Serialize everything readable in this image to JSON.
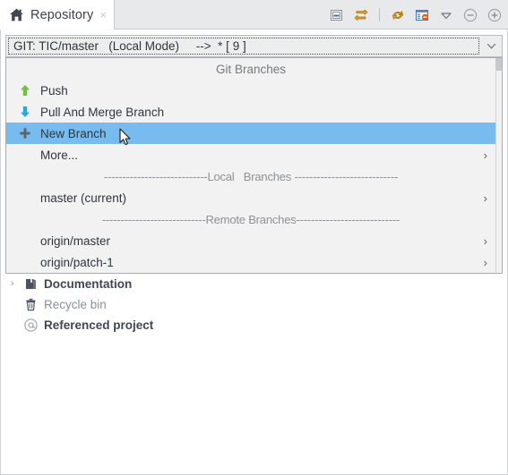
{
  "tab": {
    "title": "Repository",
    "home_icon": "home-icon",
    "close_icon": "close-icon",
    "close_glyph": "×"
  },
  "toolbar": {
    "buttons": [
      {
        "name": "minimize-view-icon",
        "title": "Minimize"
      },
      {
        "name": "sync-arrows-icon",
        "title": "Synchronize"
      },
      {
        "name": "refresh-arrows-icon",
        "title": "Refresh"
      },
      {
        "name": "properties-view-icon",
        "title": "Properties"
      },
      {
        "name": "view-menu-chevron-icon",
        "title": "View Menu"
      },
      {
        "name": "minimize-icon",
        "title": "Minimize"
      },
      {
        "name": "maximize-icon",
        "title": "Maximize"
      }
    ]
  },
  "combo": {
    "value": "GIT: TIC/master   (Local Mode)     -->  * [ 9 ]",
    "arrow_icon": "chevron-down-icon"
  },
  "dropdown": {
    "header": "Git Branches",
    "items": [
      {
        "label": "Push",
        "icon": "arrow-up-icon",
        "icon_color": "#72bf44",
        "chevron": false,
        "selected": false
      },
      {
        "label": "Pull And Merge Branch",
        "icon": "arrow-down-icon",
        "icon_color": "#29a8e0",
        "chevron": false,
        "selected": false
      },
      {
        "label": "New Branch",
        "icon": "plus-icon",
        "icon_color": "#5a6069",
        "chevron": false,
        "selected": true
      },
      {
        "label": "More...",
        "icon": "none",
        "icon_color": "",
        "chevron": true,
        "selected": false
      }
    ],
    "separator_local": "----------------------------Local   Branches ----------------------------",
    "local_branches": [
      {
        "label": "master (current)",
        "chevron": true
      }
    ],
    "separator_remote": "----------------------------Remote Branches----------------------------",
    "remote_branches": [
      {
        "label": "origin/master",
        "chevron": true
      },
      {
        "label": "origin/patch-1",
        "chevron": true
      }
    ],
    "chevron_glyph": "›"
  },
  "tree": {
    "rows": [
      {
        "label": "origin/patch-1",
        "icon": "none",
        "expander": "",
        "style": "normal",
        "hidden": true
      },
      {
        "label": "Documentation",
        "icon": "book-icon",
        "expander": "›",
        "style": "bold"
      },
      {
        "label": "Recycle bin",
        "icon": "trash-icon",
        "expander": "",
        "style": "muted"
      },
      {
        "label": "Referenced project",
        "icon": "at-icon",
        "expander": "",
        "style": "bold"
      }
    ]
  },
  "colors": {
    "selection": "#77bbef",
    "push_arrow": "#72bf44",
    "pull_arrow": "#29a8e0",
    "popup_bg": "#f2f2f2",
    "combo_bg": "#eceded",
    "tab_bar_bg": "#e7e9eb"
  }
}
